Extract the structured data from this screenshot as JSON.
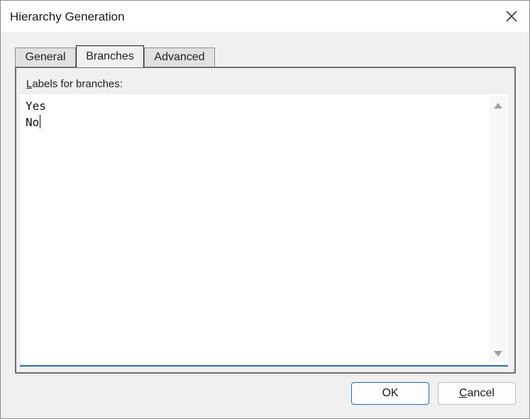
{
  "window": {
    "title": "Hierarchy Generation"
  },
  "tabs": [
    {
      "label": "General",
      "active": false
    },
    {
      "label": "Branches",
      "active": true
    },
    {
      "label": "Advanced",
      "active": false
    }
  ],
  "branches": {
    "label_mnemonic": "L",
    "label_rest": "abels for branches:",
    "lines": [
      "Yes",
      "No"
    ]
  },
  "buttons": {
    "ok": "OK",
    "cancel_mnemonic": "C",
    "cancel_rest": "ancel"
  },
  "icons": {
    "close": "close-icon",
    "scroll_up": "scroll-up-arrow-icon",
    "scroll_down": "scroll-down-arrow-icon"
  },
  "colors": {
    "focus_accent": "#1f6fb2",
    "dialog_bg": "#f0f0f0"
  }
}
